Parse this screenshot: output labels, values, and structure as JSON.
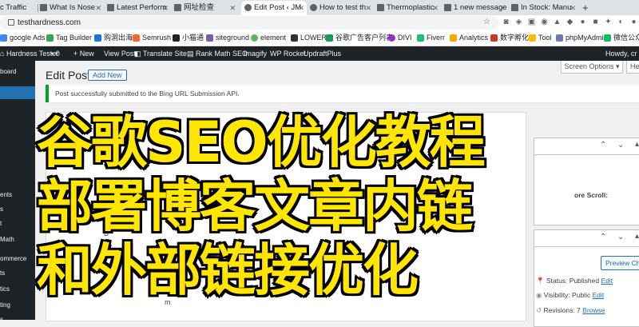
{
  "browser": {
    "tabs": [
      {
        "label": "c Traffic"
      },
      {
        "label": "What Is Nose"
      },
      {
        "label": "Latest Perform"
      },
      {
        "label": "网址检查"
      },
      {
        "label": "Edit Post ‹ JM"
      },
      {
        "label": "How to test th"
      },
      {
        "label": "Thermoplastic"
      },
      {
        "label": "1 new message"
      },
      {
        "label": "In Stock: Manu"
      }
    ],
    "url": "testhardness.com",
    "bookmarks": [
      {
        "label": "google Ads",
        "color": "#4285f4"
      },
      {
        "label": "Tag Builder",
        "color": "#34a853"
      },
      {
        "label": "购洞出海",
        "color": "#1a73e8"
      },
      {
        "label": "Semrush",
        "color": "#ff642d"
      },
      {
        "label": "小猫通",
        "color": "#222222"
      },
      {
        "label": "siteground",
        "color": "#7b5ea7"
      },
      {
        "label": "element",
        "color": "#5cb85c"
      },
      {
        "label": "LOWER",
        "color": "#333333"
      },
      {
        "label": "谷歌广告客户列表",
        "color": "#0f9d58"
      },
      {
        "label": "DIVI",
        "color": "#8f2ed6"
      },
      {
        "label": "Fiverr",
        "color": "#1dbf73"
      },
      {
        "label": "Analytics",
        "color": "#f9ab00"
      },
      {
        "label": "数字孵化",
        "color": "#d93025"
      },
      {
        "label": "Tool",
        "color": "#fbbc04"
      },
      {
        "label": "phpMyAdmin",
        "color": "#6c78af"
      },
      {
        "label": "微信公众",
        "color": "#07c160"
      }
    ]
  },
  "adminbar": {
    "site": "Hardness Tester",
    "comments": "0",
    "new": "+ New",
    "view_post": "View Post",
    "translate": "Translate Site",
    "rankmath": "Rank Math SEO",
    "imagify": "Imagify",
    "wprocket": "WP Rocket",
    "updraft": "UpdraftPlus",
    "howdy": "Howdy, cr"
  },
  "sidebar": {
    "items": [
      {
        "label": "board"
      },
      {
        "label": "ents"
      },
      {
        "label": "s"
      },
      {
        "label": "t"
      },
      {
        "label": "Math"
      },
      {
        "label": "ommerce"
      },
      {
        "label": "ts"
      },
      {
        "label": "tics"
      },
      {
        "label": "ting"
      },
      {
        "label": "s"
      }
    ]
  },
  "main": {
    "title": "Edit Post",
    "add_new": "Add New",
    "screen_options": "Screen Options ▾",
    "help": "He",
    "notice": "Post successfully submitted to the Bing URL Submission API.",
    "partial_text": "m",
    "panel": {
      "bore_scroll": "ore Scroll:",
      "preview": "Preview Chan",
      "status_label": "Status: Published",
      "status_link": "Edit",
      "visibility_label": "Visibility: Public",
      "visibility_link": "Edit",
      "revisions_label": "Revisions: 7",
      "revisions_link": "Browse"
    }
  },
  "overlay": {
    "line1": "谷歌SEO优化教程",
    "line2": "部署博客文章内链",
    "line3": "和外部链接优化"
  }
}
